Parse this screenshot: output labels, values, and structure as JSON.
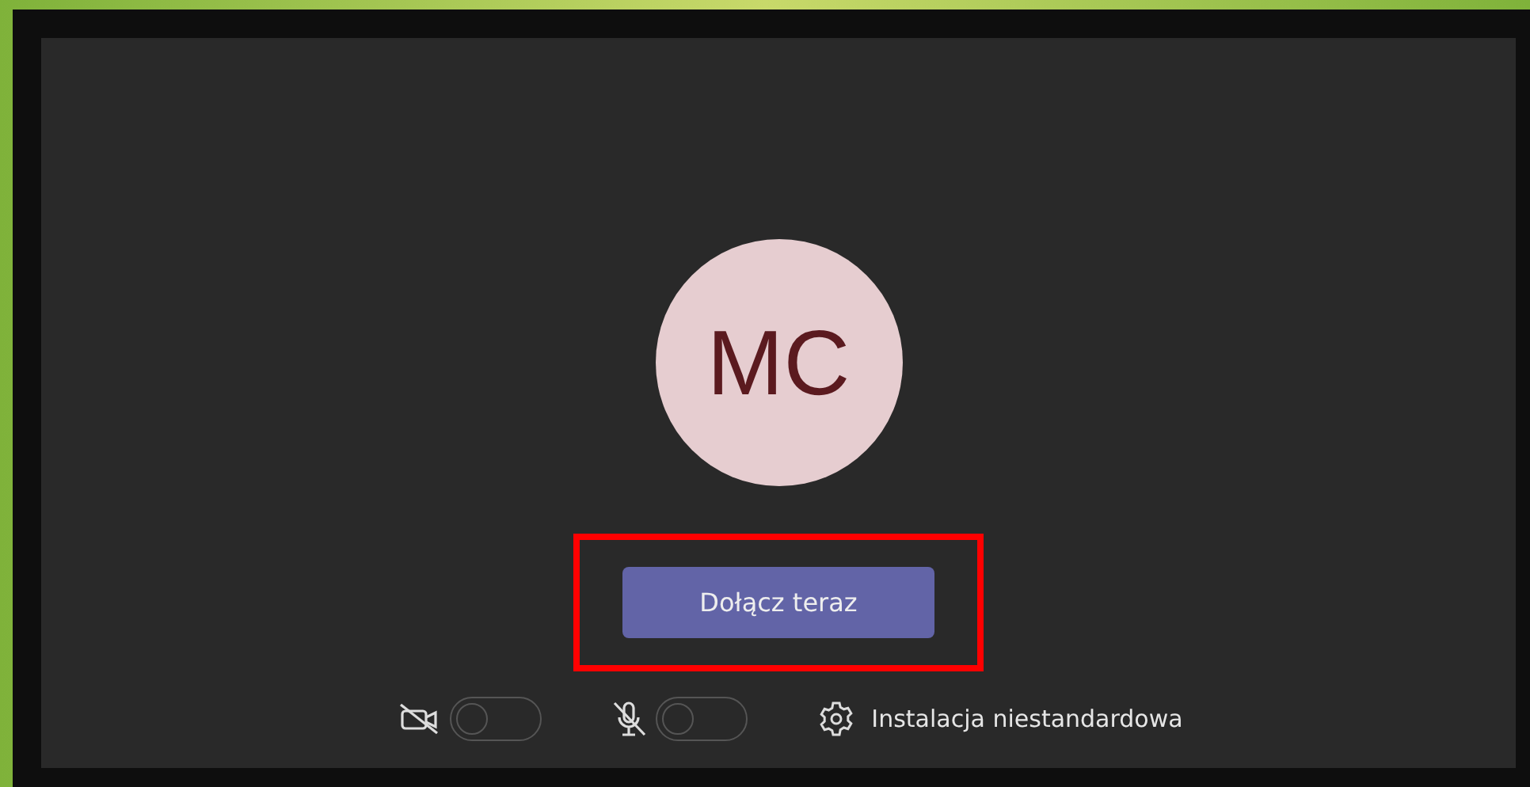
{
  "avatar": {
    "initials": "MC"
  },
  "join_button": {
    "label": "Dołącz teraz",
    "highlighted": true
  },
  "toggles": [
    {
      "kind": "camera",
      "on": false
    },
    {
      "kind": "microphone",
      "on": false
    }
  ],
  "custom_setup": {
    "label": "Instalacja niestandardowa"
  }
}
